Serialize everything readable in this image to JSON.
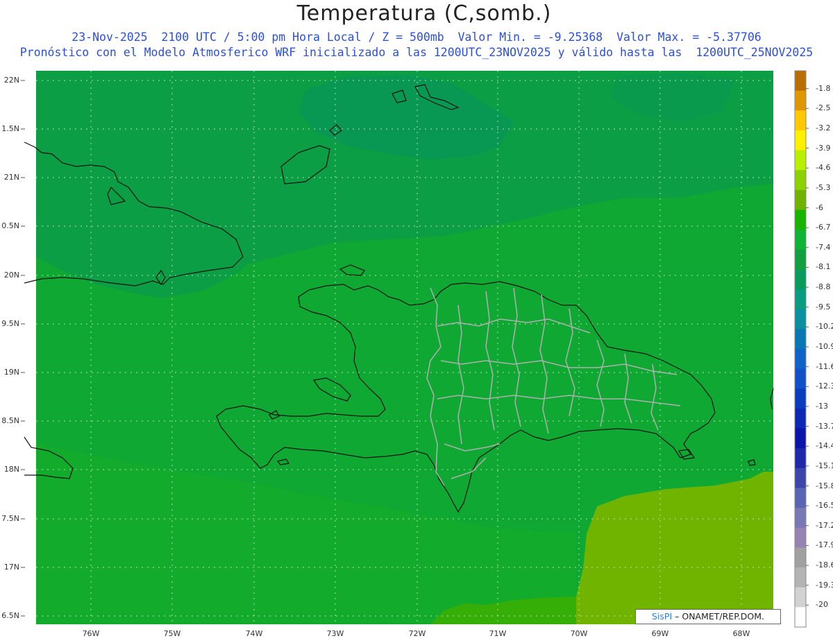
{
  "header": {
    "title": "Temperatura (C,somb.)",
    "line1": "23-Nov-2025  2100 UTC / 5:00 pm Hora Local / Z = 500mb  Valor Min. = -9.25368  Valor Max. = -5.37706",
    "line2": "Pronóstico con el Modelo Atmosferico WRF inicializado a las 1200UTC_23NOV2025 y válido hasta las  1200UTC_25NOV2025"
  },
  "axes": {
    "y_ticks": [
      "22N",
      "1.5N",
      "21N",
      "0.5N",
      "20N",
      "9.5N",
      "19N",
      "8.5N",
      "18N",
      "7.5N",
      "17N",
      "6.5N"
    ],
    "x_ticks": [
      "76W",
      "75W",
      "74W",
      "73W",
      "72W",
      "71W",
      "70W",
      "69W",
      "68W"
    ]
  },
  "colorbar": {
    "labels": [
      "-1.8",
      "-2.5",
      "-3.2",
      "-3.9",
      "-4.6",
      "-5.3",
      "-6",
      "-6.7",
      "-7.4",
      "-8.1",
      "-8.8",
      "-9.5",
      "-10.2",
      "-10.9",
      "-11.6",
      "-12.3",
      "-13",
      "-13.7",
      "-14.4",
      "-15.1",
      "-15.8",
      "-16.5",
      "-17.2",
      "-17.9",
      "-18.6",
      "-19.3",
      "-20"
    ],
    "colors": [
      "#b86e00",
      "#e09600",
      "#ffc800",
      "#fff000",
      "#b8f000",
      "#8cd200",
      "#70b400",
      "#18b400",
      "#10b434",
      "#10a040",
      "#089c5c",
      "#089c80",
      "#0890a0",
      "#0878b4",
      "#0c64c8",
      "#1050c8",
      "#0a3cbe",
      "#0a28b4",
      "#0a14aa",
      "#1e28aa",
      "#3c46aa",
      "#5a64b4",
      "#7878b4",
      "#9682b4",
      "#a0a0a0",
      "#b4b4b4",
      "#d2d2d2",
      "#ffffff"
    ]
  },
  "credit": {
    "brand": "SisPI",
    "org": " – ONAMET/REP.DOM."
  }
}
